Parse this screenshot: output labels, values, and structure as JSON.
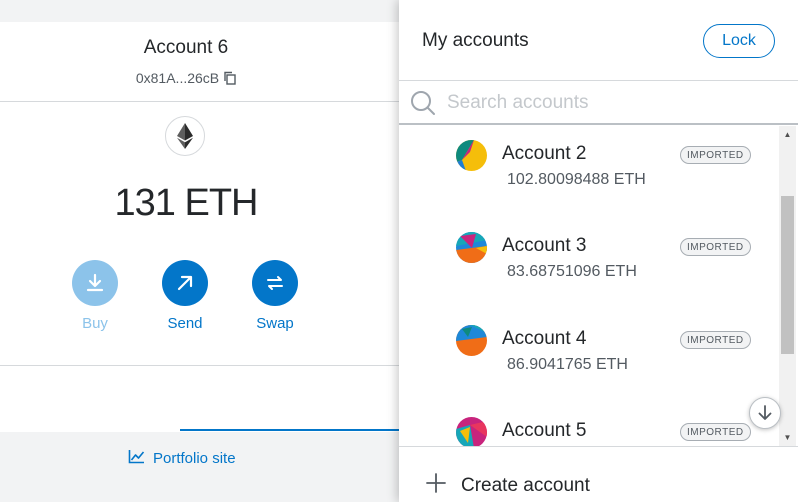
{
  "wallet": {
    "account_name": "Account 6",
    "address": "0x81A...26cB",
    "balance": "131 ETH",
    "actions": [
      {
        "label": "Buy",
        "icon": "download-icon"
      },
      {
        "label": "Send",
        "icon": "arrow-up-right-icon"
      },
      {
        "label": "Swap",
        "icon": "swap-arrows-icon"
      }
    ],
    "portfolio_link": "Portfolio site"
  },
  "menu": {
    "title": "My accounts",
    "lock_label": "Lock",
    "search_placeholder": "Search accounts",
    "accounts": [
      {
        "name": "Account 2",
        "balance": "102.80098488 ETH",
        "badge": "IMPORTED"
      },
      {
        "name": "Account 3",
        "balance": "83.68751096 ETH",
        "badge": "IMPORTED"
      },
      {
        "name": "Account 4",
        "balance": "86.9041765 ETH",
        "badge": "IMPORTED"
      },
      {
        "name": "Account 5",
        "balance": "",
        "badge": "IMPORTED"
      }
    ],
    "create_label": "Create account"
  },
  "colors": {
    "accent": "#0376c9",
    "accent_disabled": "#8cc3ea",
    "text": "#24272a",
    "muted": "#535a61",
    "border": "#d6d9dc"
  }
}
